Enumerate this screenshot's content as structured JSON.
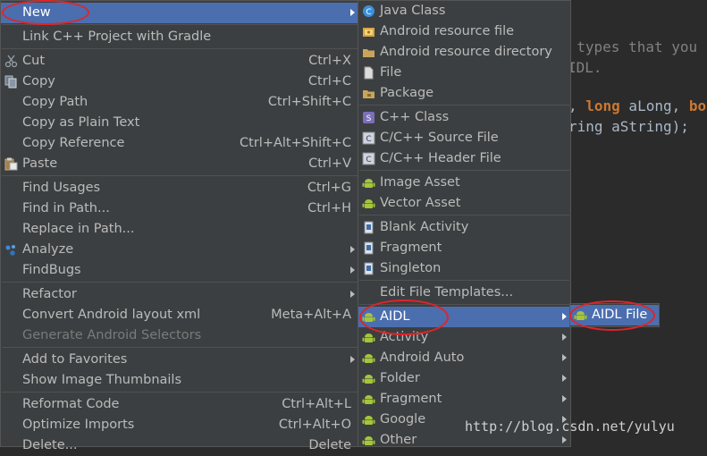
{
  "editor": {
    "line1": ": types that you",
    "line2": "IDL.",
    "line3_kw1": "long",
    "line3_mid": " aLong, ",
    "line3_kw2": "bo",
    "line3_pre": ", ",
    "line4": "ring aString);"
  },
  "main_menu": {
    "items": [
      {
        "label": "New"
      },
      {
        "label": "Link C++ Project with Gradle"
      },
      {
        "label": "Cut",
        "shortcut": "Ctrl+X"
      },
      {
        "label": "Copy",
        "shortcut": "Ctrl+C"
      },
      {
        "label": "Copy Path",
        "shortcut": "Ctrl+Shift+C"
      },
      {
        "label": "Copy as Plain Text"
      },
      {
        "label": "Copy Reference",
        "shortcut": "Ctrl+Alt+Shift+C"
      },
      {
        "label": "Paste",
        "shortcut": "Ctrl+V"
      },
      {
        "label": "Find Usages",
        "shortcut": "Ctrl+G"
      },
      {
        "label": "Find in Path...",
        "shortcut": "Ctrl+H"
      },
      {
        "label": "Replace in Path..."
      },
      {
        "label": "Analyze"
      },
      {
        "label": "FindBugs"
      },
      {
        "label": "Refactor"
      },
      {
        "label": "Convert Android layout xml",
        "shortcut": "Meta+Alt+A"
      },
      {
        "label": "Generate Android Selectors"
      },
      {
        "label": "Add to Favorites"
      },
      {
        "label": "Show Image Thumbnails"
      },
      {
        "label": "Reformat Code",
        "shortcut": "Ctrl+Alt+L"
      },
      {
        "label": "Optimize Imports",
        "shortcut": "Ctrl+Alt+O"
      },
      {
        "label": "Delete...",
        "shortcut": "Delete"
      }
    ]
  },
  "new_menu": {
    "items": [
      {
        "label": "Java Class"
      },
      {
        "label": "Android resource file"
      },
      {
        "label": "Android resource directory"
      },
      {
        "label": "File"
      },
      {
        "label": "Package"
      },
      {
        "label": "C++ Class"
      },
      {
        "label": "C/C++ Source File"
      },
      {
        "label": "C/C++ Header File"
      },
      {
        "label": "Image Asset"
      },
      {
        "label": "Vector Asset"
      },
      {
        "label": "Blank Activity"
      },
      {
        "label": "Fragment"
      },
      {
        "label": "Singleton"
      },
      {
        "label": "Edit File Templates..."
      },
      {
        "label": "AIDL"
      },
      {
        "label": "Activity"
      },
      {
        "label": "Android Auto"
      },
      {
        "label": "Folder"
      },
      {
        "label": "Fragment"
      },
      {
        "label": "Google"
      },
      {
        "label": "Other"
      }
    ]
  },
  "aidl_menu": {
    "items": [
      {
        "label": "AIDL File"
      }
    ]
  },
  "watermark": "http://blog.csdn.net/yulyu",
  "colors": {
    "menu_bg": "#3c3f41",
    "selection": "#4b6eaf",
    "annotation": "#e0242a",
    "android_green": "#a4c639"
  }
}
